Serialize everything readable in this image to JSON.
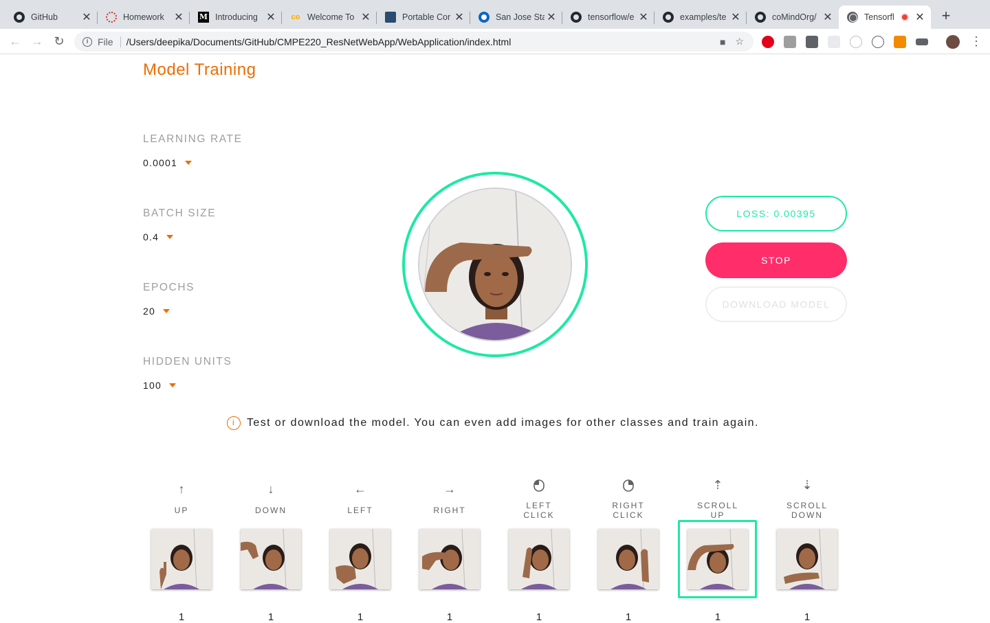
{
  "browser": {
    "tabs": [
      {
        "title": "GitHub",
        "icon": "github-icon"
      },
      {
        "title": "Homework",
        "icon": "ring-icon"
      },
      {
        "title": "Introducing",
        "icon": "medium-icon"
      },
      {
        "title": "Welcome To",
        "icon": "colab-icon"
      },
      {
        "title": "Portable Cor",
        "icon": "document-icon"
      },
      {
        "title": "San Jose Sta",
        "icon": "sjsu-icon"
      },
      {
        "title": "tensorflow/e",
        "icon": "github-icon"
      },
      {
        "title": "examples/te",
        "icon": "github-icon"
      },
      {
        "title": "coMindOrg/",
        "icon": "github-icon"
      },
      {
        "title": "Tensorfl",
        "icon": "globe-icon",
        "active": true,
        "recording": true
      }
    ],
    "scheme": "File",
    "url": "/Users/deepika/Documents/GitHub/CMPE220_ResNetWebApp/WebApplication/index.html"
  },
  "page": {
    "title": "Model Training",
    "accent_color": "#ef6c00",
    "highlight_color": "#1de9a4",
    "stop_color": "#ff2d6a",
    "hyperparams": [
      {
        "label": "LEARNING RATE",
        "value": "0.0001"
      },
      {
        "label": "BATCH SIZE",
        "value": "0.4"
      },
      {
        "label": "EPOCHS",
        "value": "20"
      },
      {
        "label": "HIDDEN UNITS",
        "value": "100"
      }
    ],
    "buttons": {
      "loss": "LOSS: 0.00395",
      "stop": "STOP",
      "download": "DOWNLOAD MODEL"
    },
    "status": "Test or download the model. You can even add images for other classes and train again.",
    "classes": [
      {
        "label": "UP",
        "icon": "arrow-up-icon",
        "glyph": "↑",
        "count": "1"
      },
      {
        "label": "DOWN",
        "icon": "arrow-down-icon",
        "glyph": "↓",
        "count": "1"
      },
      {
        "label": "LEFT",
        "icon": "arrow-left-icon",
        "glyph": "←",
        "count": "1"
      },
      {
        "label": "RIGHT",
        "icon": "arrow-right-icon",
        "glyph": "→",
        "count": "1"
      },
      {
        "label": "LEFT CLICK",
        "lines": [
          "LEFT",
          "CLICK"
        ],
        "icon": "mouse-left-icon",
        "count": "1"
      },
      {
        "label": "RIGHT CLICK",
        "lines": [
          "RIGHT",
          "CLICK"
        ],
        "icon": "mouse-right-icon",
        "count": "1"
      },
      {
        "label": "SCROLL UP",
        "lines": [
          "SCROLL",
          "UP"
        ],
        "icon": "scroll-up-icon",
        "glyph": "⇡",
        "count": "1",
        "selected": true
      },
      {
        "label": "SCROLL DOWN",
        "lines": [
          "SCROLL",
          "DOWN"
        ],
        "icon": "scroll-down-icon",
        "glyph": "⇣",
        "count": "1"
      }
    ]
  }
}
